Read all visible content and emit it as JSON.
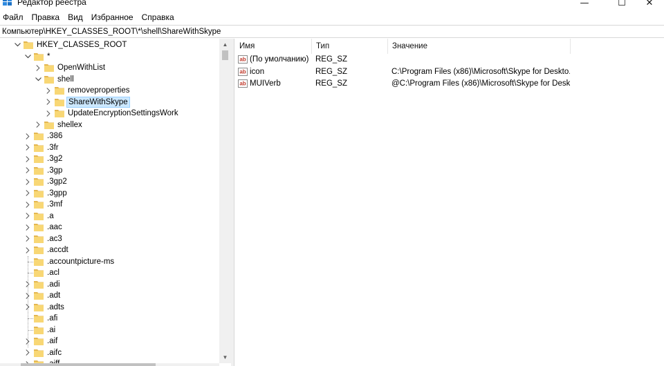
{
  "window": {
    "title": "Редактор реестра",
    "minimize_glyph": "—",
    "maximize_glyph": "☐",
    "close_glyph": "✕"
  },
  "menu": [
    "Файл",
    "Правка",
    "Вид",
    "Избранное",
    "Справка"
  ],
  "address": "Компьютер\\HKEY_CLASSES_ROOT\\*\\shell\\ShareWithSkype",
  "tree": [
    {
      "label": "HKEY_CLASSES_ROOT",
      "level": 0,
      "expanded": true
    },
    {
      "label": "*",
      "level": 1,
      "expanded": true
    },
    {
      "label": "OpenWithList",
      "level": 2,
      "expanded": false
    },
    {
      "label": "shell",
      "level": 2,
      "expanded": true
    },
    {
      "label": "removeproperties",
      "level": 3,
      "expanded": false
    },
    {
      "label": "ShareWithSkype",
      "level": 3,
      "expanded": false,
      "selected": true
    },
    {
      "label": "UpdateEncryptionSettingsWork",
      "level": 3,
      "expanded": false
    },
    {
      "label": "shellex",
      "level": 2,
      "expanded": false
    },
    {
      "label": ".386",
      "level": 1,
      "expanded": false
    },
    {
      "label": ".3fr",
      "level": 1,
      "expanded": false
    },
    {
      "label": ".3g2",
      "level": 1,
      "expanded": false
    },
    {
      "label": ".3gp",
      "level": 1,
      "expanded": false
    },
    {
      "label": ".3gp2",
      "level": 1,
      "expanded": false
    },
    {
      "label": ".3gpp",
      "level": 1,
      "expanded": false
    },
    {
      "label": ".3mf",
      "level": 1,
      "expanded": false
    },
    {
      "label": ".a",
      "level": 1,
      "expanded": false
    },
    {
      "label": ".aac",
      "level": 1,
      "expanded": false
    },
    {
      "label": ".ac3",
      "level": 1,
      "expanded": false
    },
    {
      "label": ".accdt",
      "level": 1,
      "expanded": false
    },
    {
      "label": ".accountpicture-ms",
      "level": 1,
      "leaf": true
    },
    {
      "label": ".acl",
      "level": 1,
      "leaf": true
    },
    {
      "label": ".adi",
      "level": 1,
      "expanded": false
    },
    {
      "label": ".adt",
      "level": 1,
      "expanded": false
    },
    {
      "label": ".adts",
      "level": 1,
      "expanded": false
    },
    {
      "label": ".afi",
      "level": 1,
      "leaf": true
    },
    {
      "label": ".ai",
      "level": 1,
      "leaf": true
    },
    {
      "label": ".aif",
      "level": 1,
      "expanded": false
    },
    {
      "label": ".aifc",
      "level": 1,
      "expanded": false
    },
    {
      "label": ".aiff",
      "level": 1,
      "expanded": false
    }
  ],
  "list": {
    "columns": {
      "name": "Имя",
      "type": "Тип",
      "value": "Значение"
    },
    "rows": [
      {
        "name": "(По умолчанию)",
        "type": "REG_SZ",
        "value": ""
      },
      {
        "name": "icon",
        "type": "REG_SZ",
        "value": "C:\\Program Files (x86)\\Microsoft\\Skype for Deskto..."
      },
      {
        "name": "MUIVerb",
        "type": "REG_SZ",
        "value": "@C:\\Program Files (x86)\\Microsoft\\Skype for Desk..."
      }
    ]
  },
  "colors": {
    "selection_bg": "#cce8ff",
    "selection_border": "#99d1ff",
    "folder": "#f8d775",
    "folder_dark": "#e3b650",
    "regsz_red": "#c0392b"
  },
  "icons": {
    "app": "registry-editor-icon",
    "folder": "folder-icon",
    "string_value": "ab-string-value-icon"
  }
}
